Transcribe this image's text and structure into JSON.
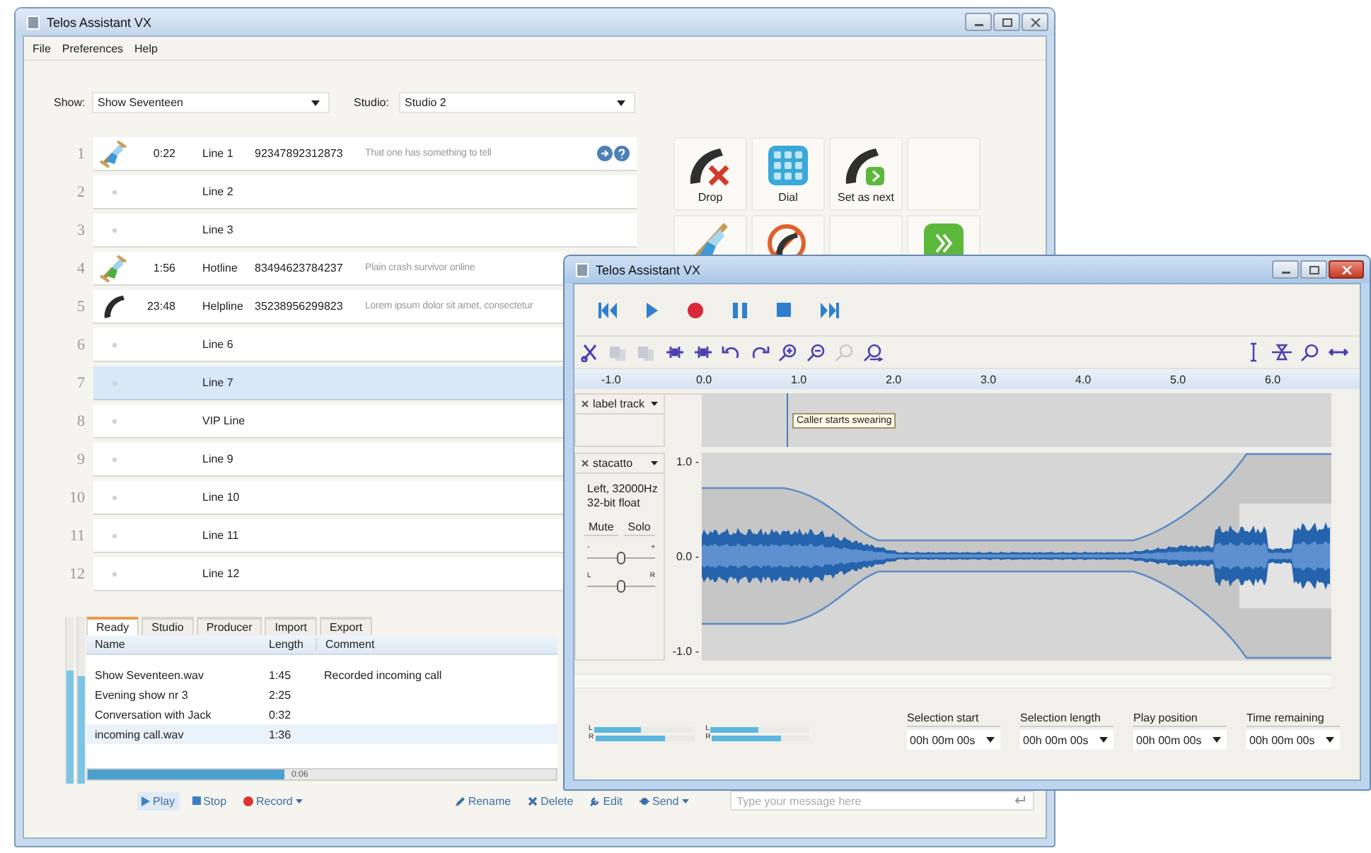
{
  "main_window": {
    "title": "Telos Assistant VX",
    "menu": [
      "File",
      "Preferences",
      "Help"
    ],
    "show": {
      "label": "Show:",
      "value": "Show Seventeen"
    },
    "studio": {
      "label": "Studio:",
      "value": "Studio 2"
    },
    "lines": [
      {
        "number": "1",
        "kind": "waiting",
        "time": "0:22",
        "name": "Line 1",
        "phone": "92347892312873",
        "note": "That one has something to tell",
        "selected": false,
        "badges": true
      },
      {
        "number": "2",
        "kind": "idle",
        "name": "Line 2",
        "selected": false,
        "badges": false
      },
      {
        "number": "3",
        "kind": "idle",
        "name": "Line 3",
        "selected": false,
        "badges": false
      },
      {
        "number": "4",
        "kind": "ready",
        "time": "1:56",
        "name": "Hotline",
        "phone": "83494623784237",
        "note": "Plain crash survivor online",
        "selected": false,
        "badges": false
      },
      {
        "number": "5",
        "kind": "on-air",
        "time": "23:48",
        "name": "Helpline",
        "phone": "35238956299823",
        "note": "Lorem ipsum dolor sit amet, consectetur",
        "selected": false,
        "badges": false
      },
      {
        "number": "6",
        "kind": "idle",
        "name": "Line 6",
        "selected": false,
        "badges": false
      },
      {
        "number": "7",
        "kind": "idle",
        "name": "Line 7",
        "selected": true,
        "badges": false
      },
      {
        "number": "8",
        "kind": "idle",
        "name": "VIP Line",
        "selected": false,
        "badges": false
      },
      {
        "number": "9",
        "kind": "idle",
        "name": "Line 9",
        "selected": false,
        "badges": false
      },
      {
        "number": "10",
        "kind": "idle",
        "name": "Line 10",
        "selected": false,
        "badges": false
      },
      {
        "number": "11",
        "kind": "idle",
        "name": "Line 11",
        "selected": false,
        "badges": false
      },
      {
        "number": "12",
        "kind": "idle",
        "name": "Line 12",
        "selected": false,
        "badges": false
      }
    ],
    "actions": [
      {
        "kind": "drop",
        "label": "Drop"
      },
      {
        "kind": "dial",
        "label": "Dial"
      },
      {
        "kind": "next",
        "label": "Set as next"
      },
      {
        "kind": "empty"
      },
      {
        "kind": "hold"
      },
      {
        "kind": "block"
      },
      {
        "kind": "empty"
      },
      {
        "kind": "forward"
      }
    ],
    "meters": [
      {
        "level": 0.68
      },
      {
        "level": 0.64
      }
    ],
    "tabs": [
      {
        "label": "Ready",
        "selected": true
      },
      {
        "label": "Studio",
        "selected": false
      },
      {
        "label": "Producer",
        "selected": false
      },
      {
        "label": "Import",
        "selected": false
      },
      {
        "label": "Export",
        "selected": false
      }
    ],
    "recordings": {
      "columns": [
        "Name",
        "Length",
        "Comment"
      ],
      "rows": [
        {
          "name": "Show Seventeen.wav",
          "length": "1:45",
          "comment": "Recorded incoming call",
          "selected": false
        },
        {
          "name": "Evening show nr 3",
          "length": "2:25",
          "selected": false
        },
        {
          "name": "Conversation with Jack",
          "length": "0:32",
          "selected": false
        },
        {
          "name": "incoming call.wav",
          "length": "1:36",
          "selected": true
        }
      ]
    },
    "playback": {
      "level": 0.42,
      "time": "0:06"
    },
    "transport": [
      {
        "kind": "play",
        "label": "Play",
        "selected": true,
        "dropdown": false
      },
      {
        "kind": "stop",
        "label": "Stop",
        "selected": false,
        "dropdown": false
      },
      {
        "kind": "record",
        "label": "Record",
        "selected": false,
        "dropdown": true
      }
    ],
    "file_actions": [
      {
        "kind": "rename",
        "label": "Rename",
        "dropdown": false
      },
      {
        "kind": "delete",
        "label": "Delete",
        "dropdown": false
      },
      {
        "kind": "edit",
        "label": "Edit",
        "dropdown": false
      },
      {
        "kind": "send",
        "label": "Send",
        "dropdown": true
      }
    ],
    "message": {
      "placeholder": "Type your message here"
    }
  },
  "editor_window": {
    "title": "Telos Assistant VX",
    "tools": [
      {
        "kind": "trim",
        "disabled": false
      },
      {
        "kind": "copy",
        "disabled": true
      },
      {
        "kind": "paste",
        "disabled": true
      },
      {
        "kind": "split",
        "disabled": false
      },
      {
        "kind": "split2",
        "disabled": false
      },
      {
        "kind": "undo",
        "disabled": false
      },
      {
        "kind": "redo",
        "disabled": false
      },
      {
        "kind": "zoom-in",
        "disabled": false
      },
      {
        "kind": "zoom-out",
        "disabled": false
      },
      {
        "kind": "zoom-sel",
        "disabled": true
      },
      {
        "kind": "zoom-fit",
        "disabled": false
      }
    ],
    "tools_right": [
      {
        "kind": "ibeam",
        "disabled": false
      },
      {
        "kind": "envelope",
        "disabled": false
      },
      {
        "kind": "zoom",
        "disabled": false
      },
      {
        "kind": "shift",
        "disabled": false
      }
    ],
    "ruler": [
      "-1.0",
      "0.0",
      "1.0",
      "2.0",
      "3.0",
      "4.0",
      "5.0",
      "6.0"
    ],
    "label_track": {
      "name": "label track",
      "label": "Caller starts swearing"
    },
    "audio_track": {
      "name": "stacatto",
      "info": [
        "Left, 32000Hz",
        "32-bit float"
      ],
      "mute": "Mute",
      "solo": "Solo",
      "gain": {
        "min": "-",
        "max": "+",
        "level": 0.5
      },
      "pan": {
        "min": "L",
        "max": "R",
        "level": 0.5
      },
      "scale": [
        "1.0 -",
        "0.0 -",
        "-1.0 -"
      ]
    },
    "meters": [
      {
        "channels": [
          {
            "label": "L",
            "level": 0.48
          },
          {
            "label": "R",
            "level": 0.7
          }
        ]
      },
      {
        "channels": [
          {
            "label": "L",
            "level": 0.48
          },
          {
            "label": "R",
            "level": 0.7
          }
        ]
      }
    ],
    "fields": [
      {
        "label": "Selection start",
        "value": "00h 00m 00s"
      },
      {
        "label": "Selection length",
        "value": "00h 00m 00s"
      },
      {
        "label": "Play position",
        "value": "00h 00m 00s"
      },
      {
        "label": "Time remaining",
        "value": "00h 00m 00s"
      }
    ]
  }
}
